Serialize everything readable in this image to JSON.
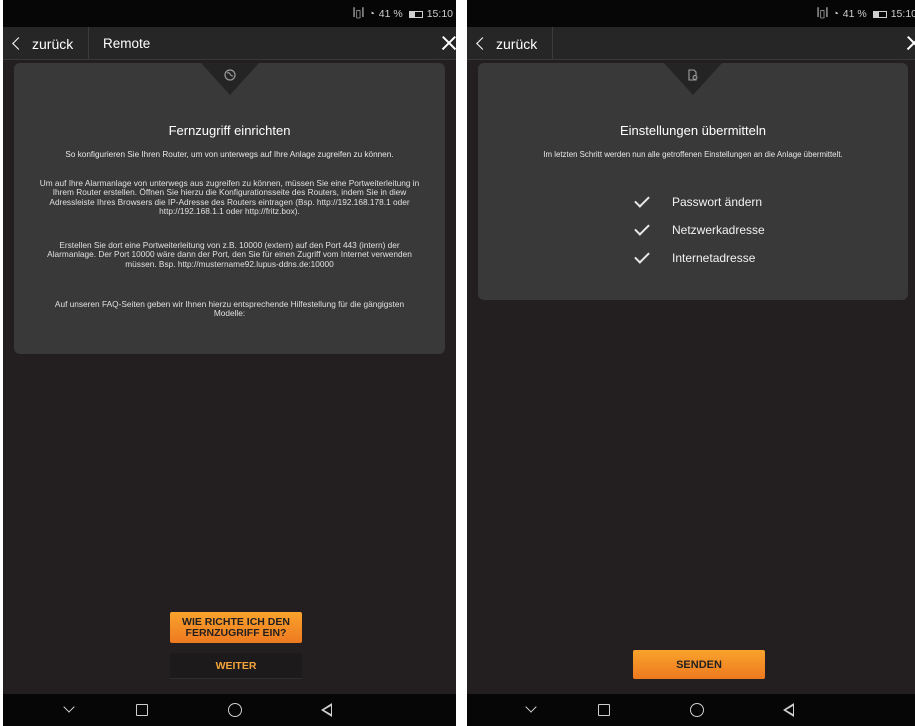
{
  "status_bar": {
    "signal_text": "ꟾ▯ꟾ",
    "battery": "41 %",
    "time": "15:10"
  },
  "left": {
    "back_label": "zurück",
    "title": "Remote",
    "notch_icon": "globe-icon",
    "card_title": "Fernzugriff einrichten",
    "card_sub": "So konfigurieren Sie Ihren Router, um von unterwegs auf Ihre Anlage zugreifen zu können.",
    "para1": "Um auf Ihre Alarmanlage von unterwegs aus zugreifen zu können, müssen Sie eine Portweiterleitung in Ihrem Router erstellen. Öffnen Sie hierzu die Konfigurationsseite des Routers, indem Sie in diew Adressleiste Ihres Browsers die IP-Adresse des Routers eintragen (Bsp. http://192.168.178.1 oder http://192.168.1.1 oder http://fritz.box).",
    "para2": "Erstellen Sie dort eine Portweiterleitung von z.B. 10000 (extern) auf den Port 443 (intern) der Alarmanlage. Der Port 10000 wäre dann der Port, den Sie für einen Zugriff vom Internet verwenden müssen. Bsp. http://mustername92.lupus-ddns.de:10000",
    "para3": "Auf unseren FAQ-Seiten geben wir Ihnen hierzu entsprechende Hilfestellung für die gängigsten Modelle:",
    "help_button": "WIE RICHTE ICH DEN FERNZUGRIFF EIN?",
    "next_button": "WEITER"
  },
  "right": {
    "back_label": "zurück",
    "notch_icon": "document-settings-icon",
    "card_title": "Einstellungen übermitteln",
    "card_sub": "Im letzten Schritt werden nun alle getroffenen Einstellungen an die Anlage übermittelt.",
    "checklist": [
      {
        "label": "Passwort ändern"
      },
      {
        "label": "Netzwerkadresse"
      },
      {
        "label": "Internetadresse"
      }
    ],
    "send_button": "SENDEN"
  },
  "colors": {
    "background": "#231f20",
    "card": "#393939",
    "accent_orange": "#f39a2a",
    "accent_text": "#f5a43b"
  }
}
